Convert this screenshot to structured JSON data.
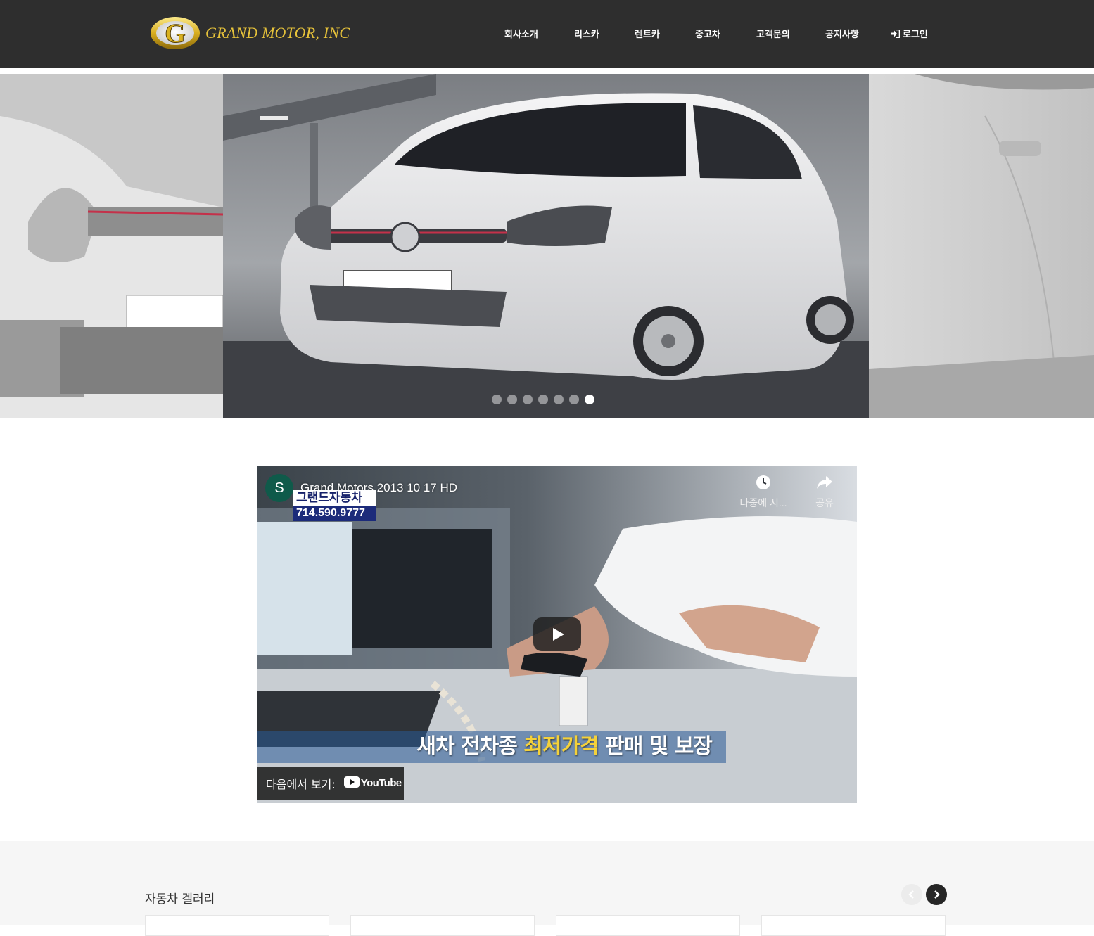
{
  "header": {
    "logo_letter": "G",
    "brand_name": "GRAND MOTOR, INC",
    "nav": [
      "회사소개",
      "리스카",
      "렌트카",
      "중고차",
      "고객문의",
      "공지사항"
    ],
    "login_label": "로그인"
  },
  "slider": {
    "slide_count": 7,
    "active_index": 6
  },
  "video": {
    "channel_initial": "S",
    "title": "Grand Motors 2013 10 17 HD",
    "brand_ko": "그랜드자동차",
    "brand_phone": "714.590.9777",
    "watch_later_label": "나중에 시...",
    "share_label": "공유",
    "caption_before": "새차 전차종 ",
    "caption_highlight": "최저가격",
    "caption_after": " 판매 및 보장",
    "watch_on_label": "다음에서 보기:",
    "youtube_label": "YouTube"
  },
  "gallery": {
    "title": "자동차 겔러리"
  },
  "colors": {
    "header_bg": "#2e2e2e",
    "logo_gold": "#e6c23a",
    "gallery_bg": "#f6f6f6"
  }
}
